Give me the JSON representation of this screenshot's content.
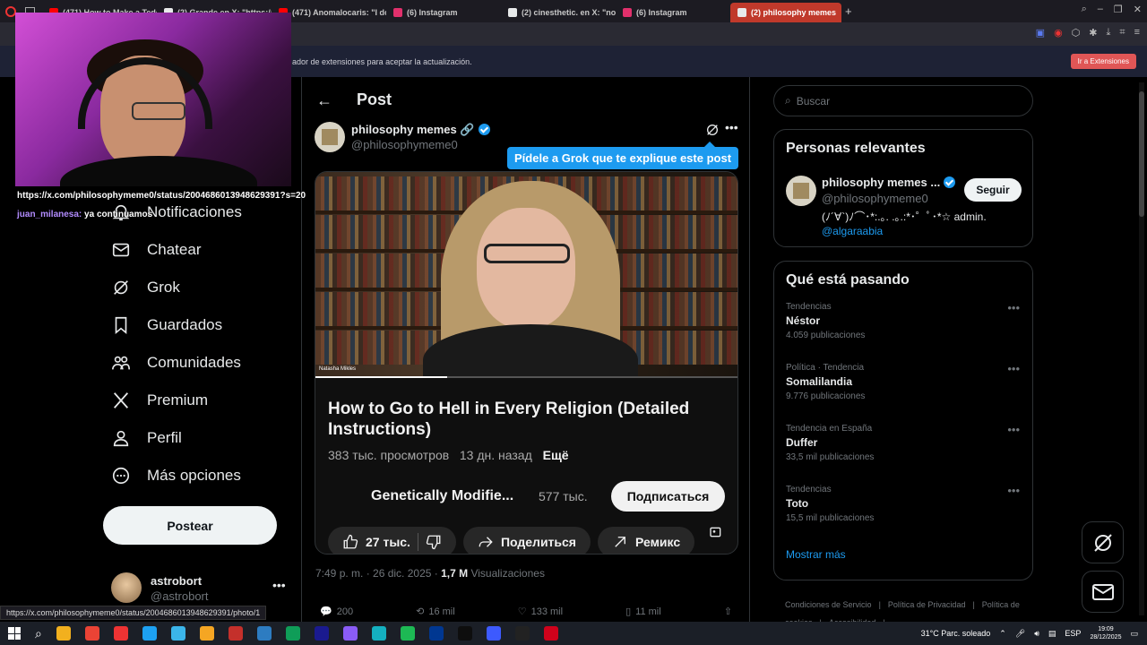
{
  "browser": {
    "tabs": [
      {
        "label": "(471) How to Make a Tede",
        "color": "#ff0000",
        "active": false
      },
      {
        "label": "(2) Grande en X: \"https://",
        "color": "#e7e9ea",
        "active": false
      },
      {
        "label": "(471) Anomalocaris: \"I do",
        "color": "#ff0000",
        "active": false
      },
      {
        "label": "(6) Instagram",
        "color": "#e1306c",
        "active": false
      },
      {
        "label": "(2) cinesthetic. en X: \"no c",
        "color": "#e7e9ea",
        "active": false
      },
      {
        "label": "(6) Instagram",
        "color": "#e1306c",
        "active": false
      },
      {
        "label": "(2) philosophy memes",
        "color": "#e7e9ea",
        "active": true
      }
    ],
    "infobar_message": "ador de extensiones para aceptar la actualización.",
    "infobar_button": "Ir a Extensiones",
    "status_url": "https://x.com/philosophymeme0/status/2004686013948629391/photo/1"
  },
  "stream": {
    "url_line": "https://x.com/philosophymeme0/status/2004686013948629391?s=20",
    "chat_user": "juan_milanesa:",
    "chat_msg": "ya continuamos",
    "user_color": "#b28cff"
  },
  "nav": {
    "items": [
      {
        "label": "Notificaciones",
        "icon": "bell-icon"
      },
      {
        "label": "Chatear",
        "icon": "mail-icon"
      },
      {
        "label": "Grok",
        "icon": "grok-icon"
      },
      {
        "label": "Guardados",
        "icon": "bookmark-icon"
      },
      {
        "label": "Comunidades",
        "icon": "communities-icon"
      },
      {
        "label": "Premium",
        "icon": "x-logo-icon"
      },
      {
        "label": "Perfil",
        "icon": "person-icon"
      },
      {
        "label": "Más opciones",
        "icon": "more-circle-icon"
      }
    ],
    "post_button": "Postear",
    "account": {
      "name": "astrobort",
      "handle": "@astrobort"
    }
  },
  "post": {
    "header_title": "Post",
    "author_name": "philosophy memes 🔗",
    "author_handle": "@philosophymeme0",
    "grok_tooltip": "Pídele a Grok que te explique este post",
    "video": {
      "caption": "Natasha Mikles",
      "progress": 0.31,
      "title": "How to Go to Hell in Every Religion (Detailed Instructions)",
      "views": "383 тыс. просмотров",
      "ago": "13 дн. назад",
      "more": "Ещё",
      "channel": "Genetically Modifie...",
      "subscribers": "577 тыс.",
      "subscribe": "Подписаться",
      "likes": "27 тыс.",
      "share": "Поделиться",
      "remix": "Ремикс"
    },
    "time": "7:49 p. m. · 26 dic. 2025 ·",
    "views_count": "1,7 M",
    "views_label": "Visualizaciones",
    "stats": {
      "replies": "200",
      "reposts": "16 mil",
      "likes": "133 mil",
      "bookmarks": "11 mil"
    }
  },
  "right": {
    "search_placeholder": "Buscar",
    "relevant_title": "Personas relevantes",
    "relevant": {
      "name": "philosophy memes ...",
      "handle": "@philosophymeme0",
      "bio": "(ﾉ´∀`)ﾉ⌒･*:.｡. .｡.:*･゜ﾟ･*☆ admin.",
      "link": "@algaraabia",
      "follow": "Seguir"
    },
    "trends_title": "Qué está pasando",
    "trends": [
      {
        "category": "Tendencias",
        "name": "Néstor",
        "count": "4.059 publicaciones"
      },
      {
        "category": "Política · Tendencia",
        "name": "Somalilandia",
        "count": "9.776 publicaciones"
      },
      {
        "category": "Tendencia en España",
        "name": "Duffer",
        "count": "33,5 mil publicaciones"
      },
      {
        "category": "Tendencias",
        "name": "Toto",
        "count": "15,5 mil publicaciones"
      }
    ],
    "show_more": "Mostrar más",
    "footer": [
      "Condiciones de Servicio",
      "|",
      "Política de Privacidad",
      "|",
      "Política de cookies",
      "|",
      "Accesibilidad",
      "|"
    ]
  },
  "taskbar": {
    "weather": "31°C  Parc. soleado",
    "lang": "ESP",
    "time": "19:09",
    "date": "28/12/2025"
  },
  "colors": {
    "accent": "#1d9bf0",
    "background": "#000000",
    "border": "#2f3336",
    "muted": "#71767b"
  }
}
